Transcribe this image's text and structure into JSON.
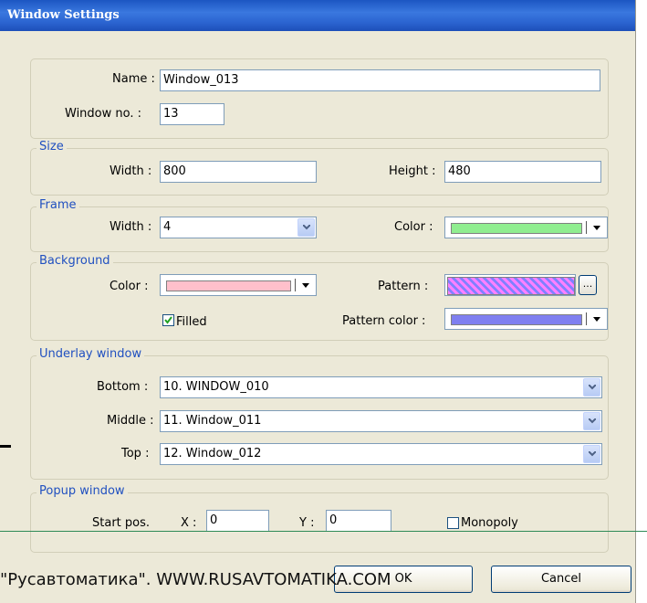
{
  "title": "Window Settings",
  "general": {
    "name_label": "Name :",
    "name_value": "Window_013",
    "winno_label": "Window no. :",
    "winno_value": "13"
  },
  "size": {
    "legend": "Size",
    "width_label": "Width :",
    "width_value": "800",
    "height_label": "Height :",
    "height_value": "480"
  },
  "frame": {
    "legend": "Frame",
    "width_label": "Width :",
    "width_value": "4",
    "color_label": "Color :",
    "color": "#90ee90"
  },
  "background": {
    "legend": "Background",
    "color_label": "Color :",
    "color": "#ffc0cb",
    "pattern_label": "Pattern :",
    "pattern_browse": "...",
    "filled_label": "Filled",
    "filled": true,
    "pattern_color_label": "Pattern color :",
    "pattern_color": "#7f7ff0"
  },
  "underlay": {
    "legend": "Underlay window",
    "bottom_label": "Bottom :",
    "bottom_value": "10. WINDOW_010",
    "middle_label": "Middle :",
    "middle_value": "11. Window_011",
    "top_label": "Top :",
    "top_value": "12. Window_012"
  },
  "popup": {
    "legend": "Popup window",
    "start_label": "Start pos.",
    "x_label": "X :",
    "x_value": "0",
    "y_label": "Y :",
    "y_value": "0",
    "monopoly_label": "Monopoly",
    "monopoly": false
  },
  "buttons": {
    "ok": "OK",
    "cancel": "Cancel"
  },
  "watermark": "\"Русавтоматика\". WWW.RUSAVTOMATIKA.COM",
  "accent_color": "#2050c0"
}
